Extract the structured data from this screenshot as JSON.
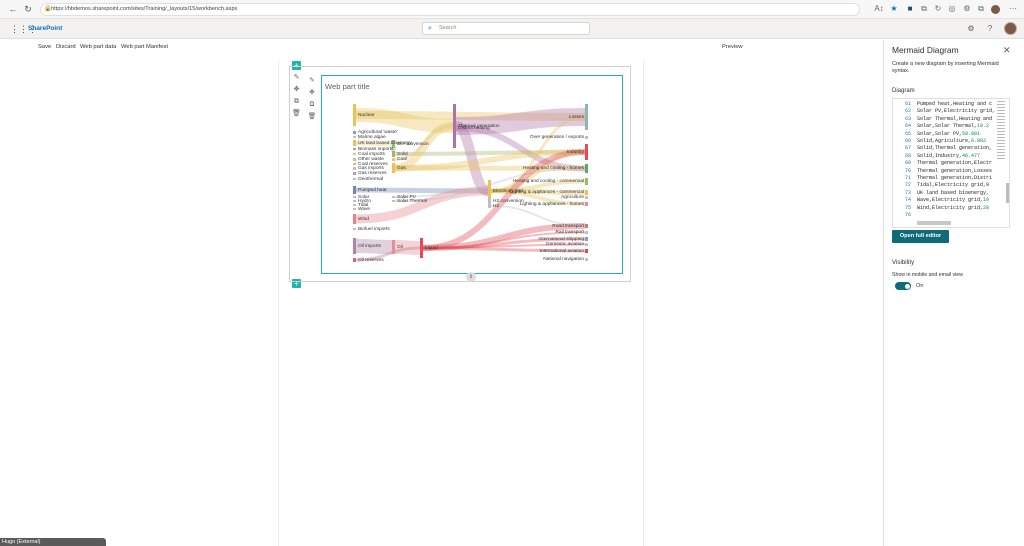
{
  "browser": {
    "url": "https://hbdemos.sharepoint.com/sites/Training/_layouts/15/workbench.aspx",
    "back_icon": "←",
    "refresh_icon": "↻",
    "extension_icons": [
      "A↕",
      "★",
      "■",
      "⧉",
      "↻",
      "◎",
      "⚙",
      "⧉",
      "⋯"
    ]
  },
  "sharepoint": {
    "brand": "SharePoint",
    "search_placeholder": "Search",
    "settings_icon": "⚙",
    "help_icon": "?"
  },
  "commands": {
    "save": "Save",
    "discard": "Discard",
    "web_part_data": "Web part data",
    "web_part_manifest": "Web part Manifest",
    "preview": "Preview"
  },
  "webpart": {
    "title": "Web part title"
  },
  "chart_data": {
    "type": "sankey",
    "title": "",
    "nodes": [
      {
        "name": "Nuclear",
        "color": "#e8c25a"
      },
      {
        "name": "Agricultural 'waste'",
        "color": "#7da0c8"
      },
      {
        "name": "Marine algae",
        "color": "#c0c0c0"
      },
      {
        "name": "UK land based bioenergy",
        "color": "#e8c25a"
      },
      {
        "name": "Biomass imports",
        "color": "#a0a0d0"
      },
      {
        "name": "Coal imports",
        "color": "#d9c98d"
      },
      {
        "name": "Other waste",
        "color": "#c0c0c0"
      },
      {
        "name": "Coal reserves",
        "color": "#e8c25a"
      },
      {
        "name": "Gas imports",
        "color": "#c0c0c0"
      },
      {
        "name": "Gas reserves",
        "color": "#b0a0c0"
      },
      {
        "name": "Geothermal",
        "color": "#c0c0c0"
      },
      {
        "name": "Pumped heat",
        "color": "#6e87b8"
      },
      {
        "name": "Solar",
        "color": "#c0c0c0"
      },
      {
        "name": "Hydro",
        "color": "#c0c0c0"
      },
      {
        "name": "Tidal",
        "color": "#c0c0c0"
      },
      {
        "name": "Wave",
        "color": "#c0c0c0"
      },
      {
        "name": "Wind",
        "color": "#e7858b"
      },
      {
        "name": "Biofuel imports",
        "color": "#c0c0c0"
      },
      {
        "name": "Oil imports",
        "color": "#b084a8"
      },
      {
        "name": "Oil reserves",
        "color": "#c07080"
      },
      {
        "name": "Bio-conversion",
        "color": "#8cc07a"
      },
      {
        "name": "Solid",
        "color": "#a8b46a"
      },
      {
        "name": "Coal",
        "color": "#d9c98d"
      },
      {
        "name": "Gas",
        "color": "#e8c25a"
      },
      {
        "name": "Solar PV",
        "color": "#c0c0c0"
      },
      {
        "name": "Solar Thermal",
        "color": "#c0c0c0"
      },
      {
        "name": "Oil",
        "color": "#e88c98"
      },
      {
        "name": "Liquid",
        "color": "#e04c58"
      },
      {
        "name": "Thermal generation",
        "color": "#b070a8"
      },
      {
        "name": "District heating",
        "color": "#b070a8"
      },
      {
        "name": "Electricity grid",
        "color": "#e8c25a"
      },
      {
        "name": "H2 conversion",
        "color": "#c0c0c0"
      },
      {
        "name": "H2",
        "color": "#c0c0c0"
      },
      {
        "name": "Losses",
        "color": "#8ab8b8"
      },
      {
        "name": "Over generation / exports",
        "color": "#c0c0c0"
      },
      {
        "name": "Industry",
        "color": "#e04c58"
      },
      {
        "name": "Heating and cooling - homes",
        "color": "#5aa86a"
      },
      {
        "name": "Heating and cooling - commercial",
        "color": "#8cc07a"
      },
      {
        "name": "Lighting & appliances - commercial",
        "color": "#e8c25a"
      },
      {
        "name": "Agriculture",
        "color": "#c0c0c0"
      },
      {
        "name": "Lighting & appliances - homes",
        "color": "#e88c98"
      },
      {
        "name": "Road transport",
        "color": "#c08070"
      },
      {
        "name": "Rail transport",
        "color": "#c0c0c0"
      },
      {
        "name": "International shipping",
        "color": "#7da0c8"
      },
      {
        "name": "Domestic aviation",
        "color": "#c0c0c0"
      },
      {
        "name": "International aviation",
        "color": "#e04c58"
      },
      {
        "name": "National navigation",
        "color": "#c0c0c0"
      }
    ]
  },
  "panel": {
    "title": "Mermaid Diagram",
    "close_icon": "✕",
    "description": "Create a new diagram by inserting Mermaid syntax.",
    "diagram_label": "Diagram",
    "open_editor": "Open full editor",
    "visibility_heading": "Visibility",
    "visibility_desc": "Show in mobile and email view",
    "toggle_label": "On",
    "code_lines": [
      {
        "n": "61",
        "text": "Pumped heat,Heating and c",
        "num": ""
      },
      {
        "n": "62",
        "text": "Solar PV,Electricity grid,",
        "num": ""
      },
      {
        "n": "63",
        "text": "Solar Thermal,Heating and",
        "num": ""
      },
      {
        "n": "64",
        "text": "Solar,Solar Thermal,",
        "num": "19.2"
      },
      {
        "n": "65",
        "text": "Solar,Solar PV,",
        "num": "59.901"
      },
      {
        "n": "66",
        "text": "Solid,Agriculture,",
        "num": "0.882"
      },
      {
        "n": "67",
        "text": "Solid,Thermal generation,",
        "num": ""
      },
      {
        "n": "68",
        "text": "Solid,Industry,",
        "num": "46.477"
      },
      {
        "n": "69",
        "text": "Thermal generation,Electr",
        "num": ""
      },
      {
        "n": "70",
        "text": "Thermal generation,Losses",
        "num": ""
      },
      {
        "n": "71",
        "text": "Thermal generation,Distri",
        "num": ""
      },
      {
        "n": "72",
        "text": "Tidal,Electricity grid,9",
        "num": ""
      },
      {
        "n": "73",
        "text": "UK land based bioenergy,",
        "num": ""
      },
      {
        "n": "74",
        "text": "Wave,Electricity grid,",
        "num": "19"
      },
      {
        "n": "75",
        "text": "Wind,Electricity grid,",
        "num": "28"
      },
      {
        "n": "76",
        "text": "",
        "num": ""
      }
    ]
  },
  "taskbar": {
    "label": "Hugo (External)"
  }
}
